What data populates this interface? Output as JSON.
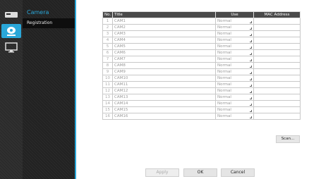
{
  "sidebar": {
    "title": "Camera",
    "items": [
      {
        "label": "Registration"
      }
    ]
  },
  "table": {
    "headers": {
      "no": "No.",
      "title": "Title",
      "use": "Use",
      "mac": "MAC Address"
    },
    "rows": [
      {
        "no": "1",
        "title": "CAM1",
        "use": "Normal",
        "mac": ""
      },
      {
        "no": "2",
        "title": "CAM2",
        "use": "Normal",
        "mac": ""
      },
      {
        "no": "3",
        "title": "CAM3",
        "use": "Normal",
        "mac": ""
      },
      {
        "no": "4",
        "title": "CAM4",
        "use": "Normal",
        "mac": ""
      },
      {
        "no": "5",
        "title": "CAM5",
        "use": "Normal",
        "mac": ""
      },
      {
        "no": "6",
        "title": "CAM6",
        "use": "Normal",
        "mac": ""
      },
      {
        "no": "7",
        "title": "CAM7",
        "use": "Normal",
        "mac": ""
      },
      {
        "no": "8",
        "title": "CAM8",
        "use": "Normal",
        "mac": ""
      },
      {
        "no": "9",
        "title": "CAM9",
        "use": "Normal",
        "mac": ""
      },
      {
        "no": "10",
        "title": "CAM10",
        "use": "Normal",
        "mac": ""
      },
      {
        "no": "11",
        "title": "CAM11",
        "use": "Normal",
        "mac": ""
      },
      {
        "no": "12",
        "title": "CAM12",
        "use": "Normal",
        "mac": ""
      },
      {
        "no": "13",
        "title": "CAM13",
        "use": "Normal",
        "mac": ""
      },
      {
        "no": "14",
        "title": "CAM14",
        "use": "Normal",
        "mac": ""
      },
      {
        "no": "15",
        "title": "CAM15",
        "use": "Normal",
        "mac": ""
      },
      {
        "no": "16",
        "title": "CAM16",
        "use": "Normal",
        "mac": ""
      }
    ]
  },
  "buttons": {
    "scan": "Scan...",
    "apply": "Apply",
    "ok": "OK",
    "cancel": "Cancel"
  },
  "icons": {
    "top": "device-icon",
    "selected": "camera-icon",
    "bottom": "monitor-icon"
  },
  "colors": {
    "accent": "#2aa7d9",
    "sidebar_bg": "#222222",
    "header_bg": "#4a4a4a"
  }
}
